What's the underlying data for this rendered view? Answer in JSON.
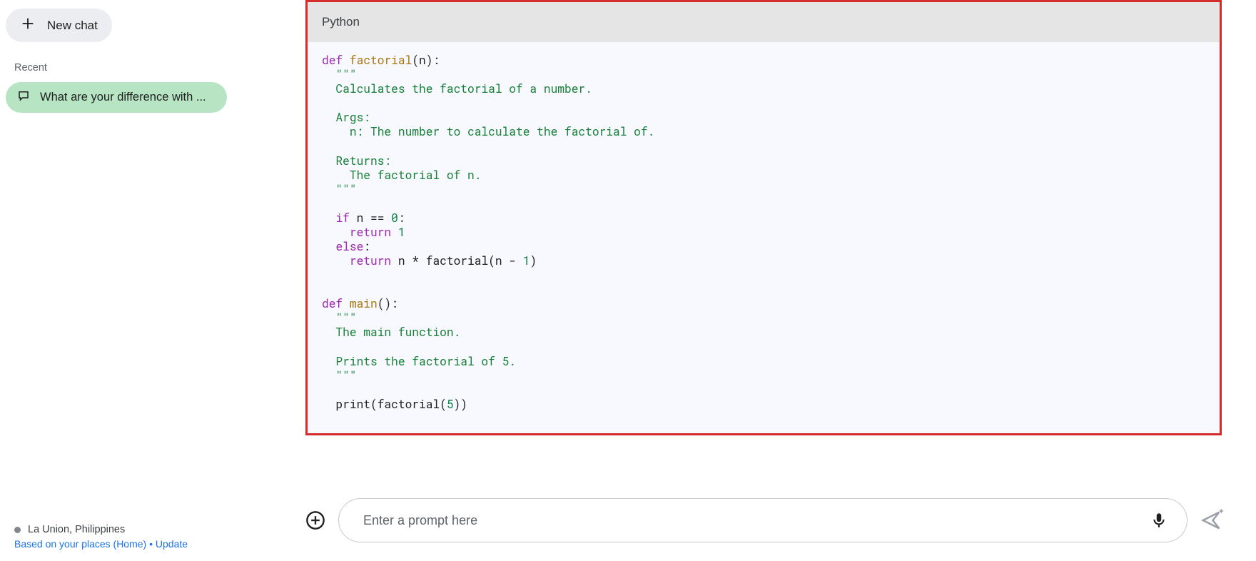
{
  "sidebar": {
    "new_chat_label": "New chat",
    "recent_label": "Recent",
    "items": [
      {
        "label": "What are your difference with ..."
      }
    ],
    "location": "La Union, Philippines",
    "location_sub": "Based on your places (Home) • Update"
  },
  "code": {
    "language_label": "Python",
    "tokens": [
      {
        "t": "kw",
        "v": "def"
      },
      {
        "t": "",
        "v": " "
      },
      {
        "t": "fn",
        "v": "factorial"
      },
      {
        "t": "",
        "v": "(n):\n  "
      },
      {
        "t": "str",
        "v": "\"\"\"\n  Calculates the factorial of a number.\n\n  Args:\n    n: The number to calculate the factorial of.\n\n  Returns:\n    The factorial of n.\n  \"\"\""
      },
      {
        "t": "",
        "v": "\n\n  "
      },
      {
        "t": "kw",
        "v": "if"
      },
      {
        "t": "",
        "v": " n == "
      },
      {
        "t": "num",
        "v": "0"
      },
      {
        "t": "",
        "v": ":\n    "
      },
      {
        "t": "kw",
        "v": "return"
      },
      {
        "t": "",
        "v": " "
      },
      {
        "t": "num",
        "v": "1"
      },
      {
        "t": "",
        "v": "\n  "
      },
      {
        "t": "kw",
        "v": "else"
      },
      {
        "t": "",
        "v": ":\n    "
      },
      {
        "t": "kw",
        "v": "return"
      },
      {
        "t": "",
        "v": " n * factorial(n - "
      },
      {
        "t": "num",
        "v": "1"
      },
      {
        "t": "",
        "v": ")\n\n\n"
      },
      {
        "t": "kw",
        "v": "def"
      },
      {
        "t": "",
        "v": " "
      },
      {
        "t": "fn",
        "v": "main"
      },
      {
        "t": "",
        "v": "():\n  "
      },
      {
        "t": "str",
        "v": "\"\"\"\n  The main function.\n\n  Prints the factorial of 5.\n  \"\"\""
      },
      {
        "t": "",
        "v": "\n\n  print(factorial("
      },
      {
        "t": "num",
        "v": "5"
      },
      {
        "t": "",
        "v": "))"
      }
    ]
  },
  "prompt": {
    "placeholder": "Enter a prompt here"
  }
}
